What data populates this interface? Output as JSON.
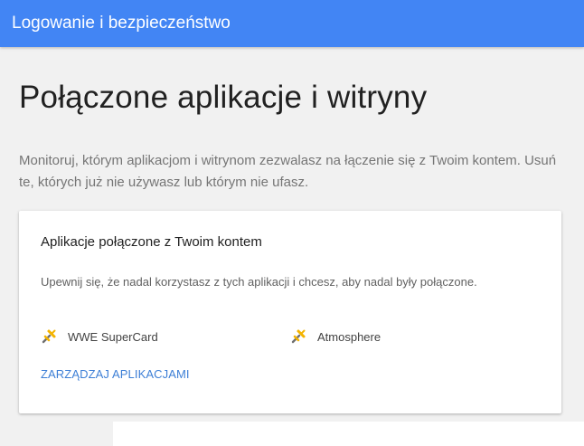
{
  "header": {
    "title": "Logowanie i bezpieczeństwo",
    "background_color": "#4285f4"
  },
  "main": {
    "title": "Połączone aplikacje i witryny",
    "description": "Monitoruj, którym aplikacjom i witrynom zezwalasz na łączenie się z Twoim kontem. Usuń te, których już nie używasz lub którym nie ufasz."
  },
  "card": {
    "title": "Aplikacje połączone z Twoim kontem",
    "description": "Upewnij się, że nadal korzystasz z tych aplikacji i chcesz, aby nadal były połączone.",
    "apps": [
      {
        "name": "WWE SuperCard",
        "icon": "connected-app-icon"
      },
      {
        "name": "Atmosphere",
        "icon": "connected-app-icon"
      }
    ],
    "manage_link": "ZARZĄDZAJ APLIKACJAMI",
    "link_color": "#3d7fd6"
  }
}
